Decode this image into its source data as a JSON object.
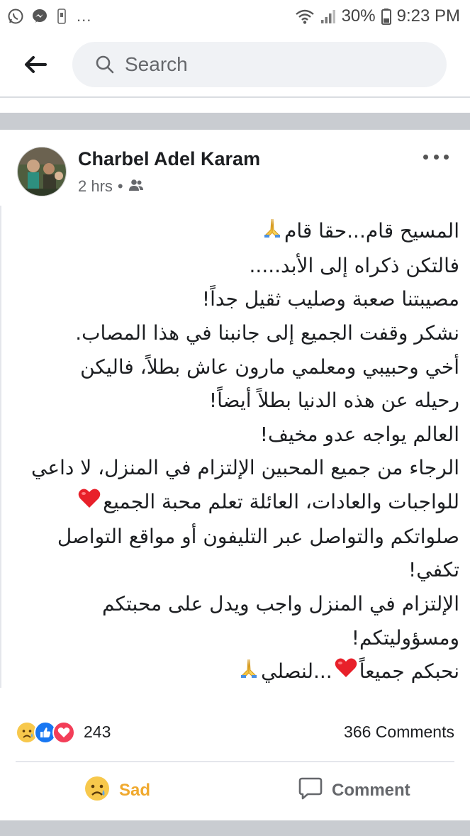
{
  "status_bar": {
    "dots": "...",
    "battery": "30%",
    "time": "9:23 PM"
  },
  "search": {
    "placeholder": "Search"
  },
  "post": {
    "author": "Charbel Adel Karam",
    "time": "2 hrs",
    "separator": "•",
    "audience_icon": "friends-icon",
    "lines": [
      "المسيح قام...حقا قام",
      "فالتكن ذكراه إلى الأبد.....",
      "مصيبتنا صعبة وصليب ثقيل جداً!",
      "نشكر وقفت الجميع إلى جانبنا في هذا المصاب.",
      "أخي وحبيبي ومعلمي مارون عاش بطلاً، فاليكن",
      "رحيله عن هذه الدنيا بطلاً أيضاً!",
      "العالم يواجه عدو مخيف!",
      "الرجاء من جميع المحبين الإلتزام في المنزل، لا داعي",
      "للواجبات والعادات، العائلة تعلم محبة الجميع",
      "صلواتكم والتواصل عبر التليفون أو مواقع التواصل",
      "تكفي!",
      "الإلتزام في المنزل واجب ويدل على محبتكم",
      "ومسؤوليتكم!",
      "نحبكم جميعاً",
      "...لنصلي"
    ]
  },
  "reactions": {
    "icons": [
      "sad-reaction-icon",
      "like-reaction-icon",
      "love-reaction-icon"
    ],
    "count": "243",
    "comments": "366 Comments"
  },
  "actions": {
    "sad_label": "Sad",
    "comment_label": "Comment"
  },
  "colors": {
    "sad_accent": "#f0a92e",
    "like_blue": "#1877f2",
    "love_red": "#f33e58"
  }
}
